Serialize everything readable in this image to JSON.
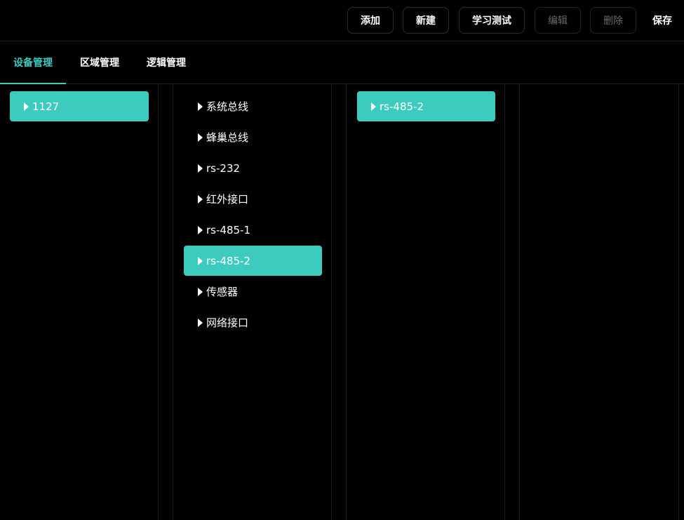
{
  "toolbar": {
    "add_label": "添加",
    "new_label": "新建",
    "learn_test_label": "学习测试",
    "edit_label": "编辑",
    "delete_label": "删除",
    "save_label": "保存"
  },
  "tabs": [
    {
      "label": "设备管理",
      "active": true
    },
    {
      "label": "区域管理",
      "active": false
    },
    {
      "label": "逻辑管理",
      "active": false
    }
  ],
  "columns": {
    "col1": {
      "items": [
        {
          "label": "1127",
          "selected": true
        }
      ]
    },
    "col2": {
      "items": [
        {
          "label": "系统总线",
          "selected": false
        },
        {
          "label": "蜂巢总线",
          "selected": false
        },
        {
          "label": "rs-232",
          "selected": false
        },
        {
          "label": "红外接口",
          "selected": false
        },
        {
          "label": "rs-485-1",
          "selected": false
        },
        {
          "label": "rs-485-2",
          "selected": true
        },
        {
          "label": "传感器",
          "selected": false
        },
        {
          "label": "网络接口",
          "selected": false
        }
      ]
    },
    "col3": {
      "items": [
        {
          "label": "rs-485-2",
          "selected": true
        }
      ]
    },
    "col4": {
      "items": []
    }
  },
  "colors": {
    "accent": "#3ecbbf",
    "background": "#000000"
  }
}
